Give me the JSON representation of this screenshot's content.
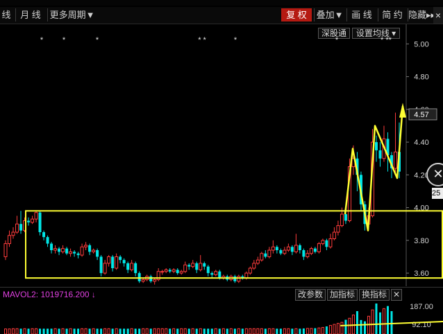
{
  "topnav": [
    "",
    "",
    "",
    "",
    "",
    "",
    "",
    ""
  ],
  "toolbar": {
    "left": [
      "线",
      "月 线",
      "更多周期▼"
    ],
    "right": [
      {
        "label": "复 权",
        "active": true
      },
      {
        "label": "叠加▼",
        "active": false
      },
      {
        "label": "画 线",
        "active": false
      },
      {
        "label": "简 约",
        "active": false
      },
      {
        "label": "隐藏▸▸",
        "active": false
      }
    ],
    "close": "×"
  },
  "buttons": {
    "depth": "深股通",
    "ma": "设置均线 ▾"
  },
  "subchart": {
    "vol_label": "MAVOL2: 1019716.200 ↓",
    "buttons": [
      "改参数",
      "加指标",
      "换指标",
      "✕"
    ],
    "top_value": "187.00",
    "mid_value": "92.10"
  },
  "side": {
    "zoom": "✕",
    "tag": "25"
  },
  "colors": {
    "up": "#ff3c3c",
    "down": "#00e6e6",
    "box": "#ffff33",
    "axis": "#d2d2d2",
    "bg": "#000000"
  },
  "chart_data": {
    "type": "candlestick",
    "title": "",
    "xlabel": "",
    "ylabel": "",
    "ylim": [
      3.52,
      5.12
    ],
    "y_ticks": [
      5.0,
      4.8,
      4.6,
      4.4,
      4.2,
      4.0,
      3.8,
      3.6
    ],
    "last_price": "4.57",
    "annotations": [
      "*",
      "*",
      "*",
      "* *",
      "*",
      "*",
      "* **"
    ],
    "candles": [
      [
        3.7,
        3.78,
        3.68,
        3.8
      ],
      [
        3.78,
        3.83,
        3.76,
        3.86
      ],
      [
        3.83,
        3.85,
        3.81,
        3.88
      ],
      [
        3.85,
        3.9,
        3.84,
        3.95
      ],
      [
        3.9,
        3.86,
        3.84,
        3.98
      ],
      [
        3.86,
        3.92,
        3.85,
        3.94
      ],
      [
        3.92,
        3.91,
        3.89,
        3.94
      ],
      [
        3.91,
        3.93,
        3.9,
        3.95
      ],
      [
        3.93,
        3.97,
        3.91,
        3.98
      ],
      [
        3.97,
        3.85,
        3.83,
        3.98
      ],
      [
        3.85,
        3.82,
        3.8,
        3.86
      ],
      [
        3.82,
        3.78,
        3.76,
        3.83
      ],
      [
        3.78,
        3.74,
        3.72,
        3.79
      ],
      [
        3.74,
        3.75,
        3.72,
        3.77
      ],
      [
        3.75,
        3.73,
        3.71,
        3.76
      ],
      [
        3.73,
        3.75,
        3.72,
        3.77
      ],
      [
        3.75,
        3.72,
        3.71,
        3.76
      ],
      [
        3.72,
        3.73,
        3.7,
        3.75
      ],
      [
        3.73,
        3.72,
        3.7,
        3.74
      ],
      [
        3.72,
        3.71,
        3.69,
        3.73
      ],
      [
        3.71,
        3.76,
        3.7,
        3.78
      ],
      [
        3.76,
        3.77,
        3.74,
        3.79
      ],
      [
        3.77,
        3.73,
        3.71,
        3.78
      ],
      [
        3.73,
        3.74,
        3.72,
        3.75
      ],
      [
        3.74,
        3.7,
        3.68,
        3.75
      ],
      [
        3.7,
        3.6,
        3.58,
        3.71
      ],
      [
        3.6,
        3.66,
        3.59,
        3.68
      ],
      [
        3.66,
        3.7,
        3.64,
        3.71
      ],
      [
        3.7,
        3.63,
        3.61,
        3.71
      ],
      [
        3.63,
        3.7,
        3.62,
        3.72
      ],
      [
        3.7,
        3.68,
        3.66,
        3.71
      ],
      [
        3.68,
        3.66,
        3.64,
        3.69
      ],
      [
        3.66,
        3.62,
        3.6,
        3.67
      ],
      [
        3.62,
        3.66,
        3.61,
        3.68
      ],
      [
        3.66,
        3.6,
        3.58,
        3.67
      ],
      [
        3.6,
        3.55,
        3.54,
        3.61
      ],
      [
        3.55,
        3.56,
        3.54,
        3.57
      ],
      [
        3.56,
        3.58,
        3.55,
        3.59
      ],
      [
        3.58,
        3.55,
        3.54,
        3.59
      ],
      [
        3.55,
        3.56,
        3.53,
        3.57
      ],
      [
        3.56,
        3.61,
        3.55,
        3.63
      ],
      [
        3.61,
        3.61,
        3.59,
        3.62
      ],
      [
        3.61,
        3.62,
        3.6,
        3.63
      ],
      [
        3.62,
        3.61,
        3.6,
        3.63
      ],
      [
        3.61,
        3.62,
        3.6,
        3.63
      ],
      [
        3.62,
        3.6,
        3.59,
        3.63
      ],
      [
        3.6,
        3.61,
        3.59,
        3.62
      ],
      [
        3.61,
        3.65,
        3.6,
        3.67
      ],
      [
        3.65,
        3.64,
        3.62,
        3.66
      ],
      [
        3.64,
        3.66,
        3.63,
        3.68
      ],
      [
        3.66,
        3.62,
        3.6,
        3.67
      ],
      [
        3.62,
        3.66,
        3.61,
        3.71
      ],
      [
        3.66,
        3.64,
        3.62,
        3.67
      ],
      [
        3.64,
        3.6,
        3.58,
        3.65
      ],
      [
        3.6,
        3.59,
        3.57,
        3.61
      ],
      [
        3.59,
        3.61,
        3.58,
        3.62
      ],
      [
        3.61,
        3.57,
        3.56,
        3.62
      ],
      [
        3.57,
        3.58,
        3.56,
        3.59
      ],
      [
        3.58,
        3.56,
        3.55,
        3.59
      ],
      [
        3.56,
        3.58,
        3.55,
        3.59
      ],
      [
        3.58,
        3.55,
        3.54,
        3.59
      ],
      [
        3.55,
        3.58,
        3.54,
        3.59
      ],
      [
        3.58,
        3.57,
        3.56,
        3.59
      ],
      [
        3.57,
        3.6,
        3.56,
        3.61
      ],
      [
        3.6,
        3.63,
        3.59,
        3.64
      ],
      [
        3.63,
        3.66,
        3.62,
        3.68
      ],
      [
        3.66,
        3.68,
        3.65,
        3.7
      ],
      [
        3.68,
        3.72,
        3.67,
        3.73
      ],
      [
        3.72,
        3.7,
        3.69,
        3.74
      ],
      [
        3.7,
        3.74,
        3.69,
        3.76
      ],
      [
        3.74,
        3.76,
        3.72,
        3.8
      ],
      [
        3.76,
        3.74,
        3.72,
        3.77
      ],
      [
        3.74,
        3.72,
        3.71,
        3.75
      ],
      [
        3.72,
        3.74,
        3.71,
        3.76
      ],
      [
        3.74,
        3.76,
        3.73,
        3.78
      ],
      [
        3.76,
        3.73,
        3.71,
        3.77
      ],
      [
        3.73,
        3.77,
        3.72,
        3.84
      ],
      [
        3.77,
        3.74,
        3.72,
        3.78
      ],
      [
        3.74,
        3.7,
        3.68,
        3.75
      ],
      [
        3.7,
        3.72,
        3.69,
        3.74
      ],
      [
        3.72,
        3.75,
        3.71,
        3.76
      ],
      [
        3.75,
        3.73,
        3.72,
        3.76
      ],
      [
        3.73,
        3.78,
        3.72,
        3.79
      ],
      [
        3.78,
        3.8,
        3.77,
        3.81
      ],
      [
        3.8,
        3.76,
        3.74,
        3.81
      ],
      [
        3.76,
        3.81,
        3.75,
        3.84
      ],
      [
        3.81,
        3.85,
        3.8,
        3.88
      ],
      [
        3.85,
        3.89,
        3.83,
        3.92
      ],
      [
        3.89,
        3.96,
        3.88,
        4.0
      ],
      [
        3.96,
        3.92,
        3.9,
        3.97
      ],
      [
        3.92,
        4.25,
        3.91,
        4.3
      ],
      [
        4.25,
        4.3,
        4.2,
        4.38
      ],
      [
        4.3,
        4.2,
        4.1,
        4.34
      ],
      [
        4.2,
        4.02,
        3.98,
        4.22
      ],
      [
        4.02,
        3.9,
        3.86,
        4.04
      ],
      [
        3.9,
        3.95,
        3.88,
        4.0
      ],
      [
        3.95,
        4.4,
        3.94,
        4.48
      ],
      [
        4.4,
        4.35,
        4.28,
        4.44
      ],
      [
        4.35,
        4.3,
        4.25,
        4.4
      ],
      [
        4.3,
        4.42,
        4.28,
        4.5
      ],
      [
        4.42,
        4.32,
        4.22,
        4.46
      ],
      [
        4.32,
        4.24,
        4.18,
        4.34
      ],
      [
        4.24,
        4.34,
        4.2,
        4.58
      ],
      [
        4.34,
        4.22,
        4.18,
        4.52
      ]
    ],
    "volume": [
      20,
      20,
      21,
      21,
      21,
      21,
      21,
      21,
      21,
      21,
      21,
      21,
      21,
      21,
      21,
      21,
      21,
      21,
      21,
      21,
      21,
      21,
      21,
      21,
      21,
      21,
      21,
      21,
      21,
      21,
      21,
      21,
      21,
      21,
      21,
      21,
      21,
      21,
      21,
      21,
      21,
      21,
      21,
      21,
      21,
      21,
      21,
      21,
      21,
      21,
      21,
      21,
      21,
      21,
      21,
      21,
      21,
      21,
      21,
      21,
      21,
      21,
      21,
      21,
      21,
      21,
      21,
      21,
      21,
      21,
      21,
      21,
      21,
      21,
      21,
      21,
      21,
      21,
      22,
      22,
      22,
      23,
      24,
      26,
      30,
      34,
      38,
      42,
      46,
      56,
      62,
      75,
      90,
      55,
      50,
      70,
      95,
      120,
      85,
      100,
      110,
      90
    ]
  }
}
